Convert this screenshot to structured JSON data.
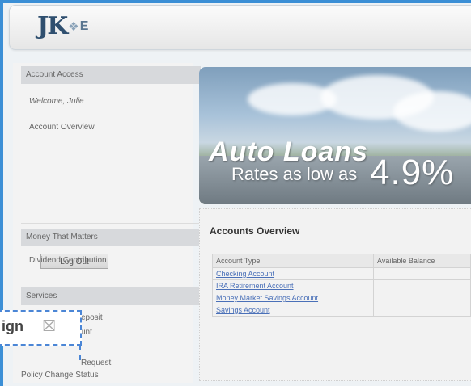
{
  "header": {
    "logo_text": "JK",
    "logo_letter": "E"
  },
  "sidebar": {
    "account_access_title": "Account Access",
    "welcome": "Welcome, Julie",
    "account_overview": "Account Overview",
    "logout": "Log Out",
    "money_title": "Money That Matters",
    "dividend": "Dividend Contribution",
    "services_title": "Services",
    "service_items": [
      "eposit",
      "unt",
      "Request",
      "Policy Change Status"
    ]
  },
  "banner": {
    "title": "Auto Loans",
    "subtitle": "Rates as low as",
    "rate": "4.9%"
  },
  "accounts": {
    "title": "Accounts Overview",
    "columns": [
      "Account Type",
      "Available Balance"
    ],
    "rows": [
      {
        "type": "Checking Account",
        "balance": ""
      },
      {
        "type": "IRA Retirement Account",
        "balance": ""
      },
      {
        "type": "Money Market Savings Account",
        "balance": ""
      },
      {
        "type": "Savings Account",
        "balance": ""
      }
    ]
  },
  "overlay": {
    "text": "ign"
  }
}
